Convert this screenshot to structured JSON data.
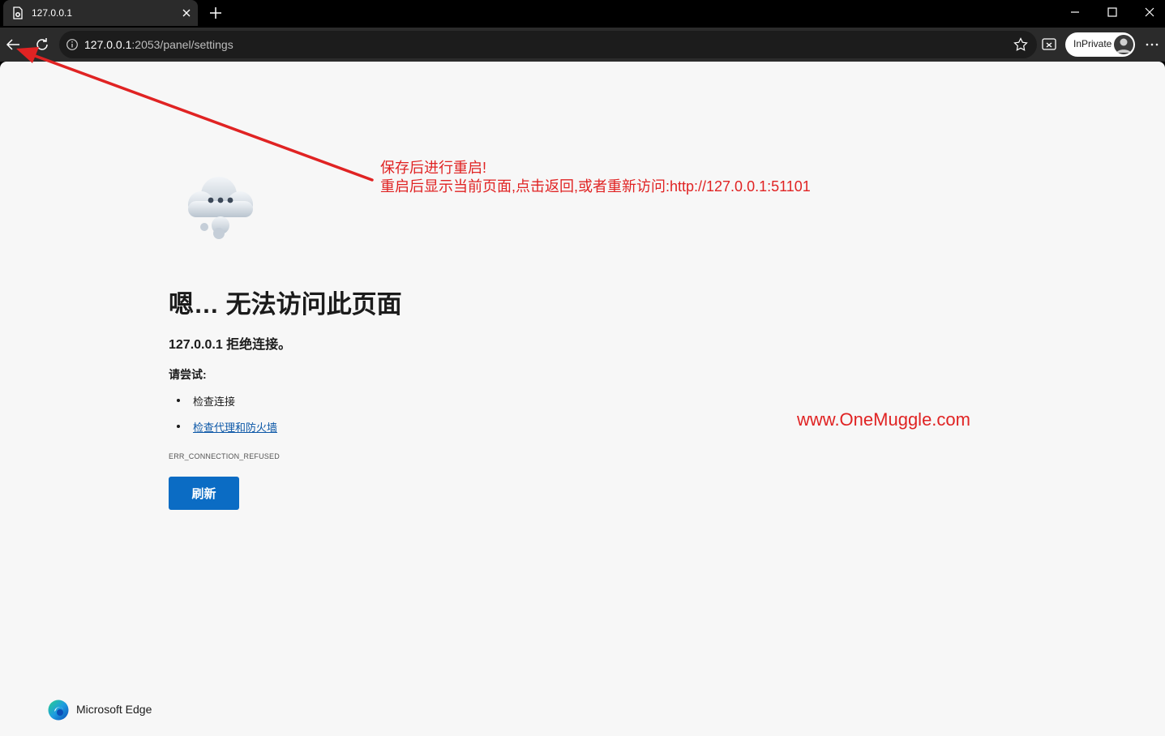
{
  "browser": {
    "tab": {
      "title": "127.0.0.1",
      "favicon": "page-error-icon"
    },
    "address": {
      "host": "127.0.0.1",
      "path": ":2053/panel/settings"
    },
    "profile_label": "InPrivate"
  },
  "error_page": {
    "title": "嗯… 无法访问此页面",
    "subtitle": "127.0.0.1 拒绝连接。",
    "try_label": "请尝试:",
    "tips": [
      "检查连接",
      "检查代理和防火墙"
    ],
    "error_code": "ERR_CONNECTION_REFUSED",
    "refresh_label": "刷新",
    "brand": "Microsoft Edge"
  },
  "annotation": {
    "line1": "保存后进行重启!",
    "line2": "重启后显示当前页面,点击返回,或者重新访问:http://127.0.0.1:51101",
    "watermark": "www.OneMuggle.com",
    "color": "#e02323"
  },
  "colors": {
    "accent": "#0b6cc4",
    "link": "#0b57a7",
    "page_bg": "#f7f7f7",
    "toolbar_bg": "#2b2b2b"
  }
}
